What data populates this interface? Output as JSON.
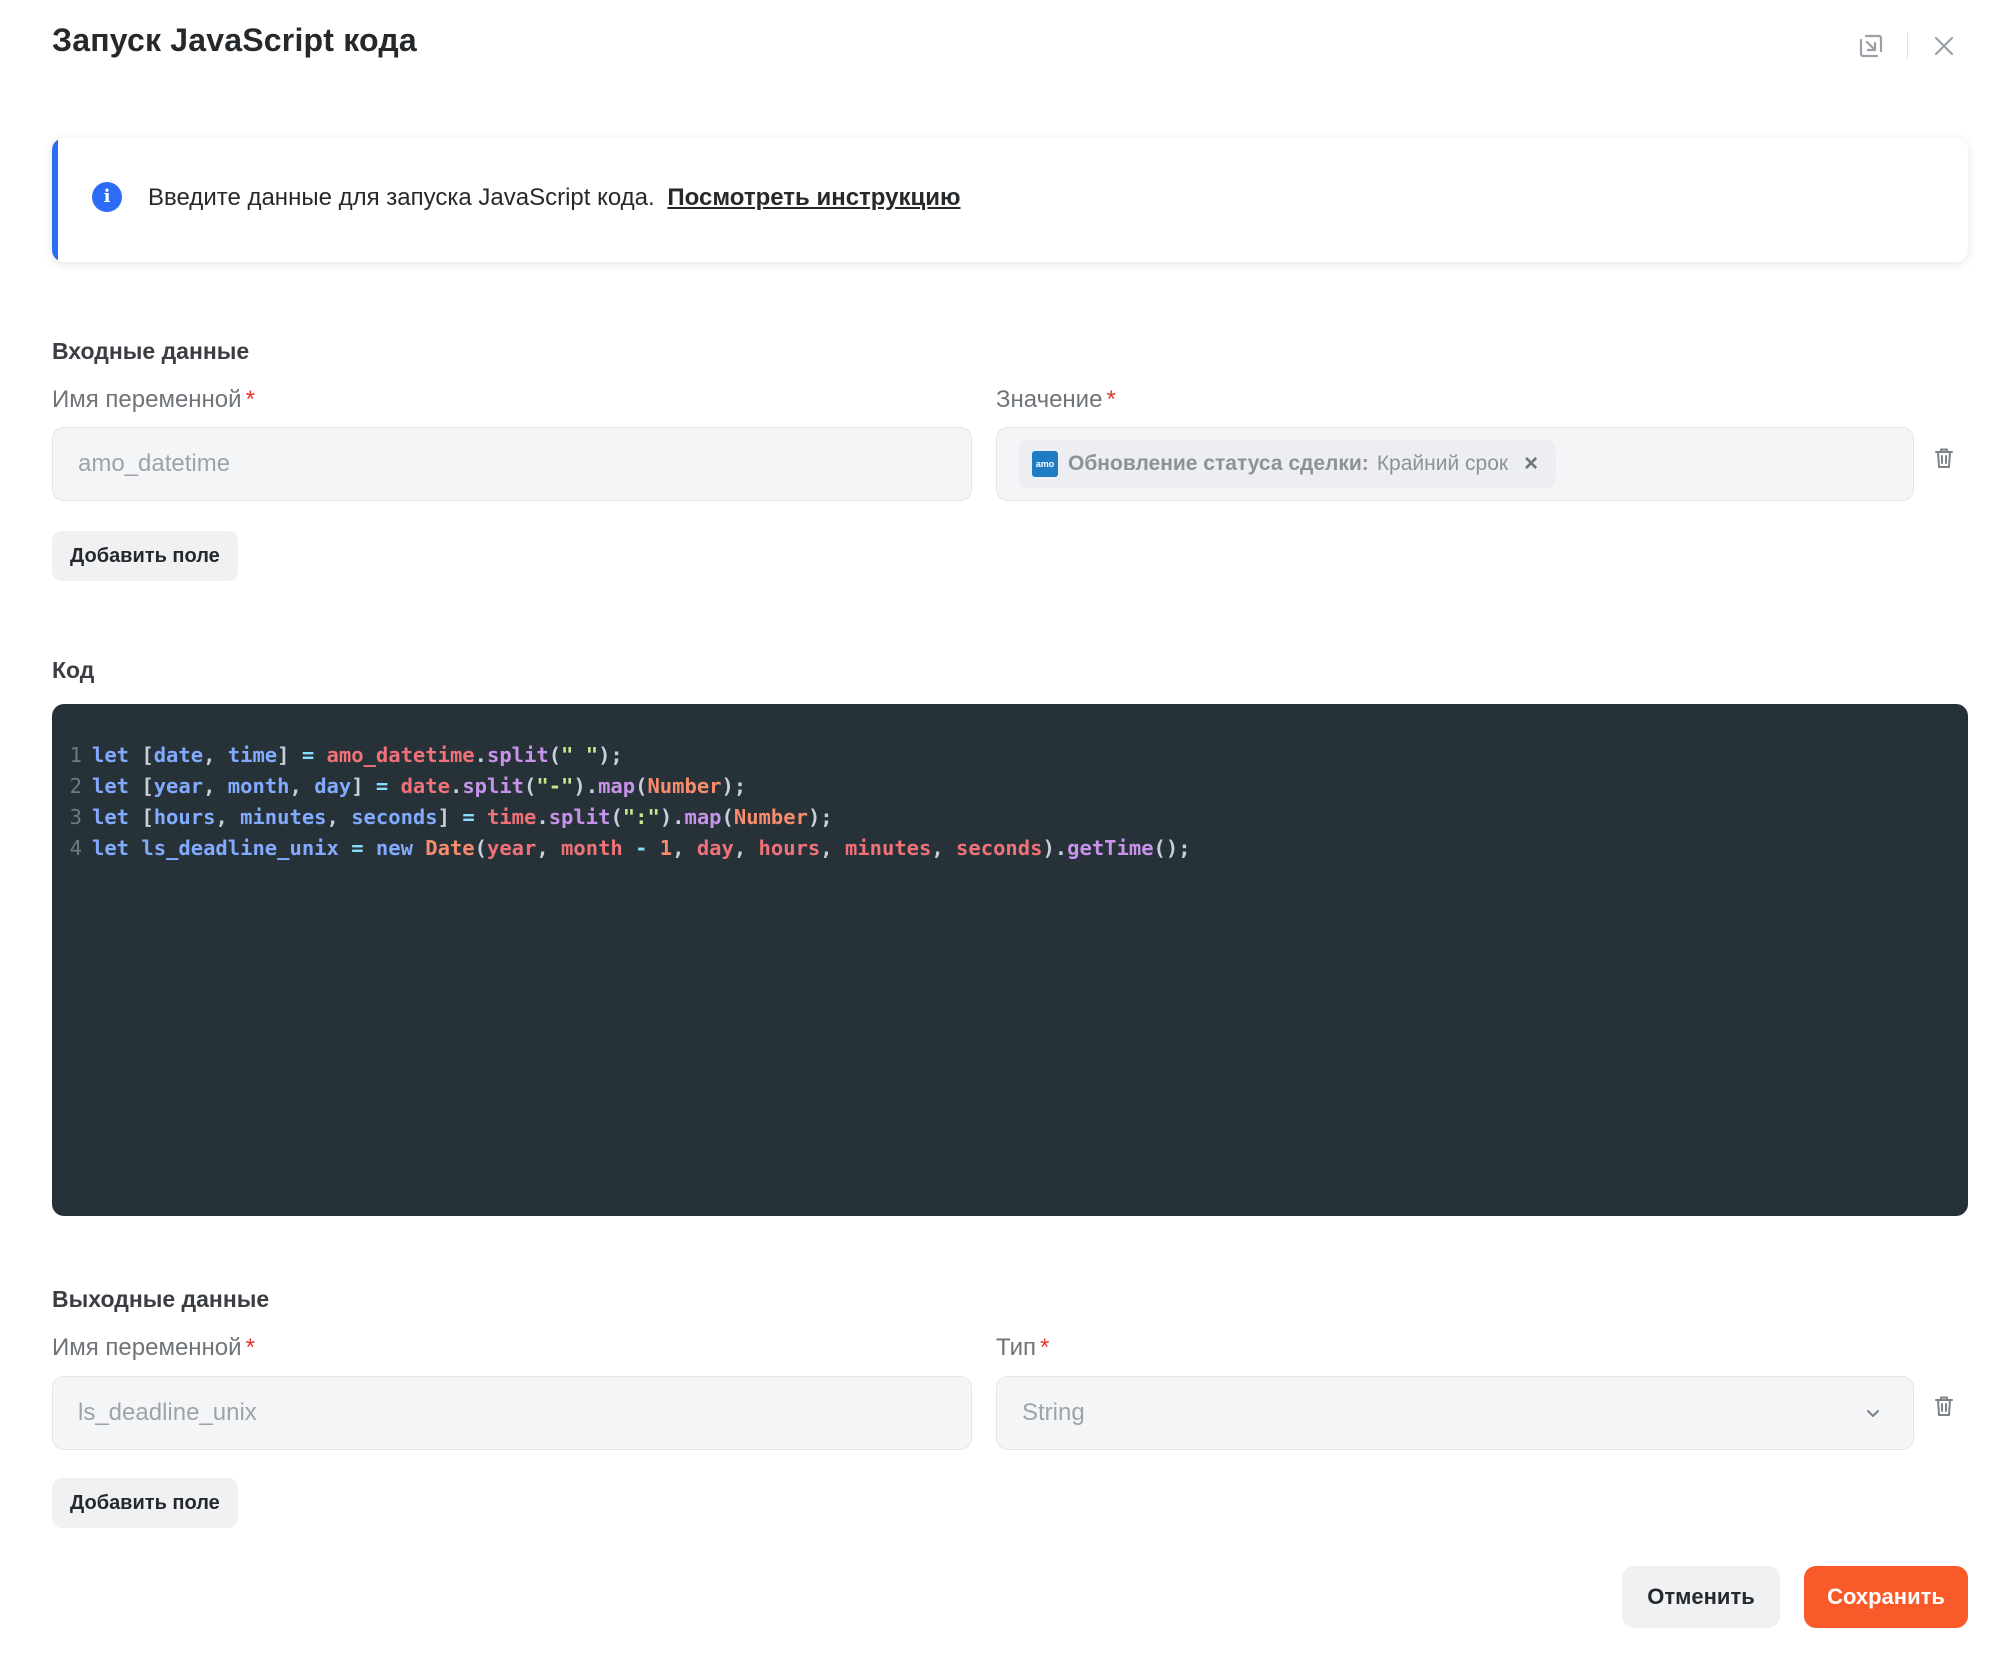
{
  "dialog": {
    "title": "Запуск JavaScript кода",
    "header_icons": [
      "collapse-to-corner-icon",
      "close-icon"
    ]
  },
  "info": {
    "text": "Введите данные для запуска JavaScript кода.",
    "link": "Посмотреть инструкцию",
    "icon": "info-icon",
    "accent_color": "#2d6df6"
  },
  "input_section": {
    "title": "Входные данные",
    "var_label": "Имя переменной",
    "value_label": "Значение",
    "required_mark": "*",
    "rows": [
      {
        "var_value": "amo_datetime",
        "chip_logo": "amo",
        "chip_source": "Обновление статуса сделки:",
        "chip_field": "Крайний срок",
        "chip_remove": "×"
      }
    ],
    "add_button": "Добавить поле"
  },
  "code_section": {
    "title": "Код",
    "lines": [
      "let [date, time] = amo_datetime.split(\" \");",
      "let [year, month, day] = date.split(\"-\").map(Number);",
      "let [hours, minutes, seconds] = time.split(\":\").map(Number);",
      "let ls_deadline_unix = new Date(year, month - 1, day, hours, minutes, seconds).getTime();"
    ],
    "line_numbers": [
      "1",
      "2",
      "3",
      "4"
    ],
    "background": "#263238"
  },
  "output_section": {
    "title": "Выходные данные",
    "var_label": "Имя переменной",
    "type_label": "Тип",
    "required_mark": "*",
    "rows": [
      {
        "var_value": "ls_deadline_unix",
        "type_value": "String"
      }
    ],
    "add_button": "Добавить поле"
  },
  "footer": {
    "cancel": "Отменить",
    "save": "Сохранить",
    "save_color": "#fa5a2a"
  }
}
